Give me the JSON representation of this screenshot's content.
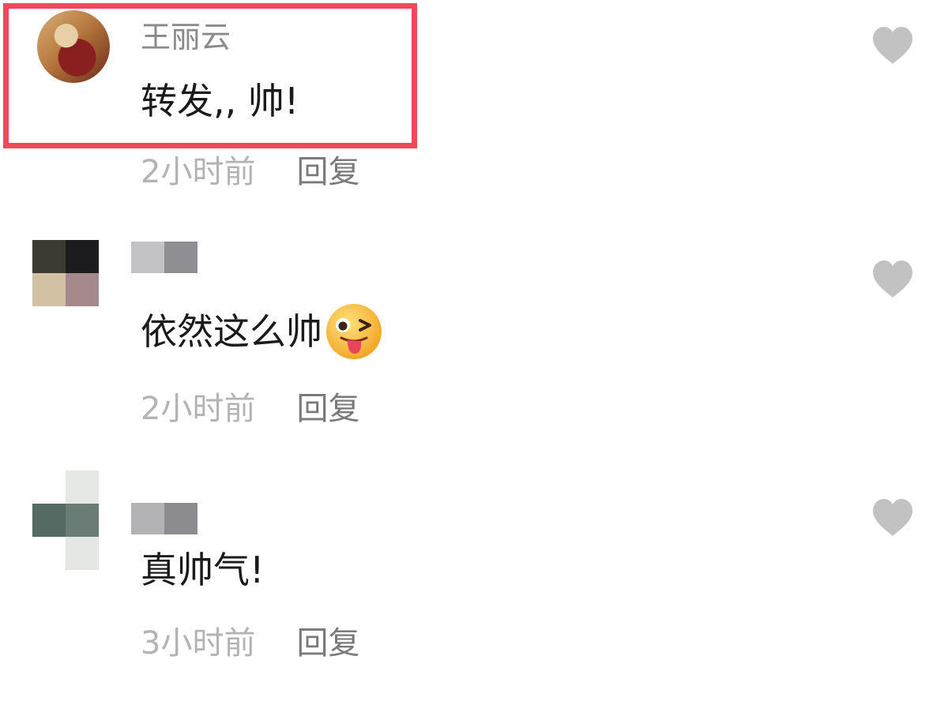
{
  "comments": [
    {
      "username": "王丽云",
      "text": "转发,, 帅!",
      "time": "2小时前",
      "reply_label": "回复",
      "like_icon": "heart-icon",
      "highlighted": true
    },
    {
      "username": "",
      "text": "依然这么帅",
      "emoji": "wink-tongue-emoji",
      "time": "2小时前",
      "reply_label": "回复",
      "like_icon": "heart-icon"
    },
    {
      "username": "",
      "text": "真帅气!",
      "time": "3小时前",
      "reply_label": "回复",
      "like_icon": "heart-icon"
    }
  ],
  "colors": {
    "highlight_border": "#f1485b",
    "like_icon": "#c2c2c2",
    "meta_text": "#b3b3b3",
    "reply_text": "#7a7a7a",
    "username_text": "#8a8a8a"
  }
}
